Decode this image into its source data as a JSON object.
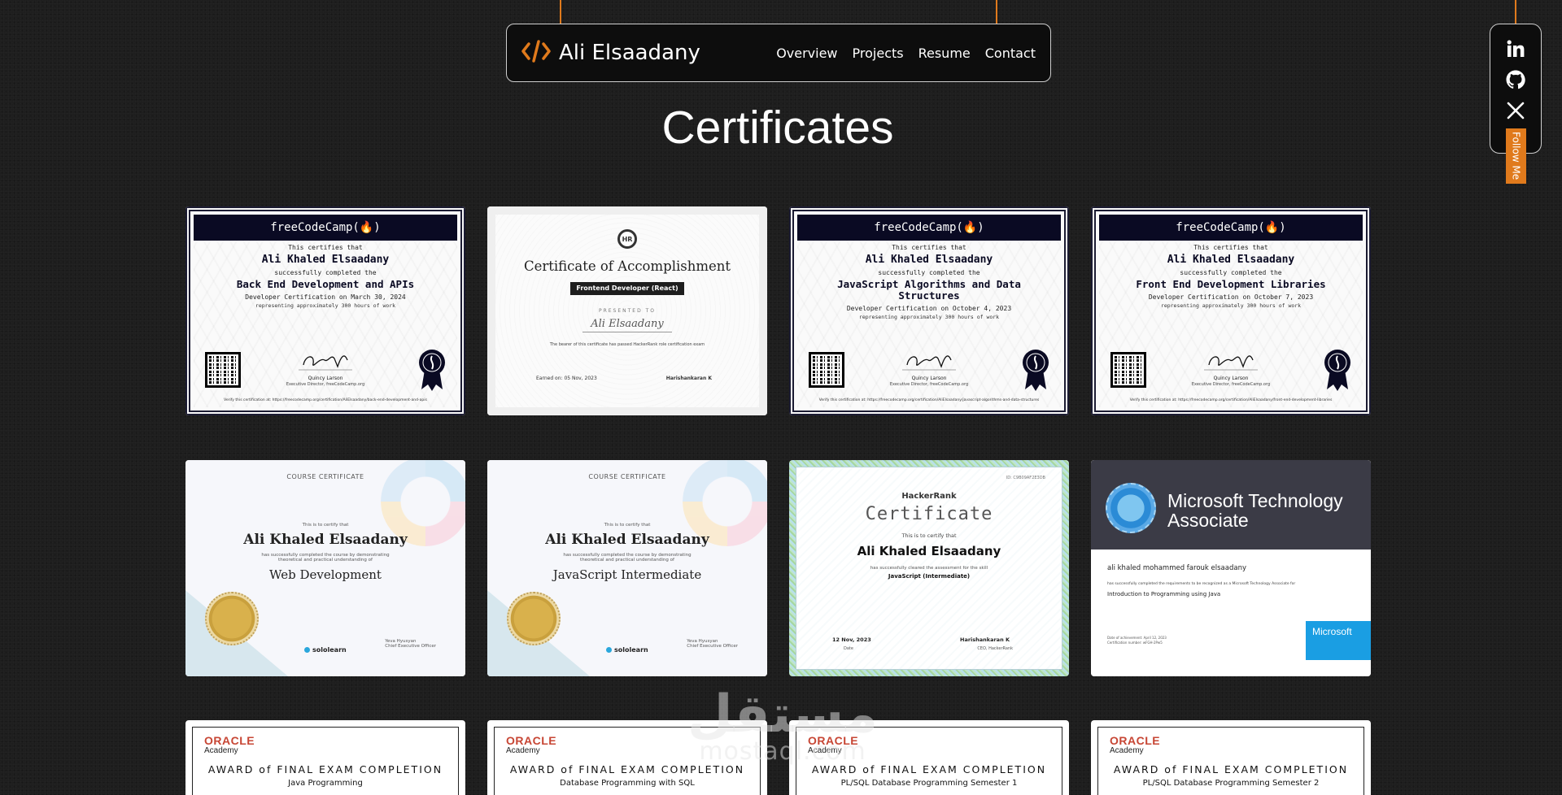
{
  "brand": {
    "name": "Ali Elsaadany",
    "icon": "code-icon"
  },
  "nav": {
    "items": [
      "Overview",
      "Projects",
      "Resume",
      "Contact"
    ]
  },
  "social": {
    "icons": [
      "linkedin-icon",
      "github-icon",
      "x-icon"
    ],
    "follow_label": "Follow Me"
  },
  "page_title": "Certificates",
  "colors": {
    "accent": "#e07a1c",
    "background": "#1e1e1e",
    "nav_bg": "#0d0d0d"
  },
  "fcc": [
    {
      "brand": "freeCodeCamp(🔥)",
      "certifies": "This certifies that",
      "name": "Ali Khaled Elsaadany",
      "completed": "successfully completed the",
      "course": "Back End Development and APIs",
      "date": "Developer Certification on March 30, 2024",
      "hours": "representing approximately 300 hours of work",
      "signer": "Quincy Larson",
      "signer_title": "Executive Director, freeCodeCamp.org",
      "verify": "Verify this certification at: https://freecodecamp.org/certification/AliElsaadany/back-end-development-and-apis"
    },
    {
      "brand": "freeCodeCamp(🔥)",
      "certifies": "This certifies that",
      "name": "Ali Khaled Elsaadany",
      "completed": "successfully completed the",
      "course": "JavaScript Algorithms and Data Structures",
      "date": "Developer Certification on October 4, 2023",
      "hours": "representing approximately 300 hours of work",
      "signer": "Quincy Larson",
      "signer_title": "Executive Director, freeCodeCamp.org",
      "verify": "Verify this certification at: https://freecodecamp.org/certification/AliElsaadany/javascript-algorithms-and-data-structures"
    },
    {
      "brand": "freeCodeCamp(🔥)",
      "certifies": "This certifies that",
      "name": "Ali Khaled Elsaadany",
      "completed": "successfully completed the",
      "course": "Front End Development Libraries",
      "date": "Developer Certification on October 7, 2023",
      "hours": "representing approximately 300 hours of work",
      "signer": "Quincy Larson",
      "signer_title": "Executive Director, freeCodeCamp.org",
      "verify": "Verify this certification at: https://freecodecamp.org/certification/AliElsaadany/front-end-development-libraries"
    }
  ],
  "hr_accomplishment": {
    "logo": "HR",
    "title": "Certificate of Accomplishment",
    "ribbon": "Frontend Developer (React)",
    "presented": "PRESENTED TO",
    "name": "Ali Elsaadany",
    "desc": "The bearer of this certificate has passed HackerRank role certification exam",
    "date": "Earned on: 05 Nov, 2023",
    "signer": "Harishankaran K"
  },
  "sololearn": [
    {
      "top": "COURSE CERTIFICATE",
      "certify": "This is to certify that",
      "name": "Ali Khaled Elsaadany",
      "desc": "has successfully completed the course by demonstrating theoretical and practical understanding of",
      "course": "Web Development",
      "ceo": "Yeva Hyusyan",
      "ceo_title": "Chief Executive Officer",
      "logo": "sololearn"
    },
    {
      "top": "COURSE CERTIFICATE",
      "certify": "This is to certify that",
      "name": "Ali Khaled Elsaadany",
      "desc": "has successfully completed the course by demonstrating theoretical and practical understanding of",
      "course": "JavaScript Intermediate",
      "ceo": "Yeva Hyusyan",
      "ceo_title": "Chief Executive Officer",
      "logo": "sololearn"
    }
  ],
  "hr_cert": {
    "id": "ID: C9B09AF2E3DB",
    "brand": "HackerRank",
    "title": "Certificate",
    "certify": "This is to certify that",
    "name": "Ali Khaled Elsaadany",
    "desc": "has successfully cleared the assessment for the skill",
    "skill": "JavaScript (Intermediate)",
    "date": "12 Nov, 2023",
    "date_label": "Date",
    "signer": "Harishankaran K",
    "signer_title": "CEO, HackerRank"
  },
  "microsoft": {
    "title_line1": "Microsoft Technology",
    "title_line2": "Associate",
    "name": "ali khaled mohammed farouk elsaadany",
    "desc": "has successfully completed the requirements to be recognized as a Microsoft Technology Associate for",
    "course": "Introduction to Programming using Java",
    "logo": "Microsoft",
    "meta1": "Date of achievement: April 12, 2023",
    "meta2": "Certification number: wFGH-2Pw5"
  },
  "oracle": [
    {
      "logo": "ORACLE",
      "academy": "Academy",
      "award": "AWARD of FINAL EXAM COMPLETION",
      "course": "Java Programming"
    },
    {
      "logo": "ORACLE",
      "academy": "Academy",
      "award": "AWARD of FINAL EXAM COMPLETION",
      "course": "Database Programming with SQL"
    },
    {
      "logo": "ORACLE",
      "academy": "Academy",
      "award": "AWARD of FINAL EXAM COMPLETION",
      "course": "PL/SQL Database Programming Semester 1"
    },
    {
      "logo": "ORACLE",
      "academy": "Academy",
      "award": "AWARD of FINAL EXAM COMPLETION",
      "course": "PL/SQL Database Programming Semester 2"
    }
  ],
  "watermark": {
    "arabic": "مستقل",
    "latin": "mostaql.com"
  }
}
